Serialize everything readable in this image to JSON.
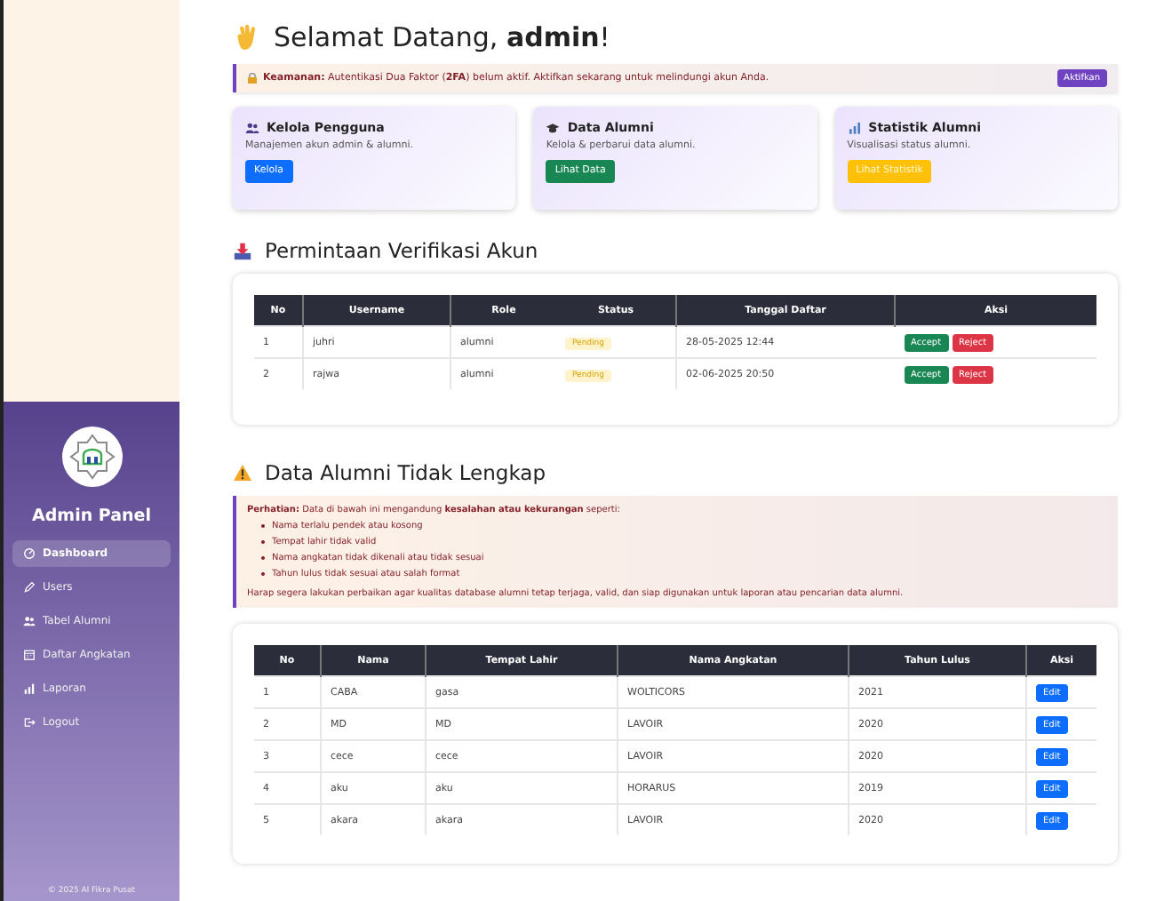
{
  "sidebar": {
    "title": "Admin Panel",
    "items": [
      {
        "label": "Dashboard",
        "selected": true
      },
      {
        "label": "Users",
        "selected": false
      },
      {
        "label": "Tabel Alumni",
        "selected": false
      },
      {
        "label": "Daftar Angkatan",
        "selected": false
      },
      {
        "label": "Laporan",
        "selected": false
      },
      {
        "label": "Logout",
        "selected": false
      }
    ],
    "footer": "© 2025 Al Fikra Pusat"
  },
  "greeting": "Selamat Datang, **admin**!",
  "security_alert": {
    "text": "**Keamanan:** Autentikasi Dua Faktor (**2FA**) belum aktif. Aktifkan sekarang untuk melindungi akun Anda.",
    "button": "Aktifkan"
  },
  "cards": [
    {
      "title": "Kelola Pengguna",
      "description": "Manajemen akun admin & alumni.",
      "button": "Kelola",
      "kind": "primary"
    },
    {
      "title": "Data Alumni",
      "description": "Kelola & perbarui data alumni.",
      "button": "Lihat Data",
      "kind": "success"
    },
    {
      "title": "Statistik Alumni",
      "description": "Visualisasi status alumni.",
      "button": "Lihat Statistik",
      "kind": "warning"
    }
  ],
  "verification": {
    "title": "Permintaan Verifikasi Akun",
    "columns": [
      "No",
      "Username",
      "Role",
      "Status",
      "Tanggal Daftar",
      "Aksi"
    ],
    "rows": [
      {
        "no": "1",
        "username": "juhri",
        "role": "alumni",
        "status": "Pending",
        "date": "28-05-2025 12:44",
        "actions": [
          "Accept",
          "Reject"
        ]
      },
      {
        "no": "2",
        "username": "rajwa",
        "role": "alumni",
        "status": "Pending",
        "date": "02-06-2025 20:50",
        "actions": [
          "Accept",
          "Reject"
        ]
      }
    ]
  },
  "incomplete": {
    "title": "Data Alumni Tidak Lengkap",
    "notice": "**Perhatian:** Data di bawah ini mengandung **kesalahan atau kekurangan** seperti:",
    "issues": [
      "Nama terlalu pendek atau kosong",
      "Tempat lahir tidak valid",
      "Nama angkatan tidak dikenali atau tidak sesuai",
      "Tahun lulus tidak sesuai atau salah format"
    ],
    "advice": "Harap segera lakukan perbaikan agar kualitas database alumni tetap terjaga, valid, dan siap digunakan untuk laporan atau pencarian data alumni.",
    "columns": [
      "No",
      "Nama",
      "Tempat Lahir",
      "Nama Angkatan",
      "Tahun Lulus",
      "Aksi"
    ],
    "rows": [
      {
        "cells": [
          "1",
          "CABA",
          "gasa",
          "WOLTICORS",
          "2021"
        ],
        "action": "Edit"
      },
      {
        "cells": [
          "2",
          "MD",
          "MD",
          "LAVOIR",
          "2020"
        ],
        "action": "Edit"
      },
      {
        "cells": [
          "3",
          "cece",
          "cece",
          "LAVOIR",
          "2020"
        ],
        "action": "Edit"
      },
      {
        "cells": [
          "4",
          "aku",
          "aku",
          "HORARUS",
          "2019"
        ],
        "action": "Edit"
      },
      {
        "cells": [
          "5",
          "akara",
          "akara",
          "LAVOIR",
          "2020"
        ],
        "action": "Edit"
      }
    ]
  }
}
